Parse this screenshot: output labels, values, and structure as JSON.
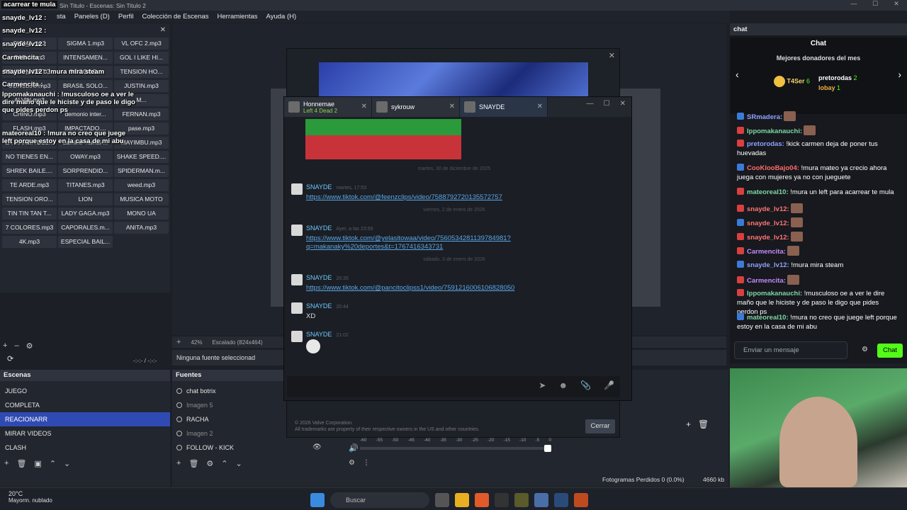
{
  "window": {
    "title": "Sin Titulo - Escenas: Sin Titulo 2",
    "ticker": "acarrear te mula"
  },
  "menu": [
    "sta",
    "Paneles (D)",
    "Perfil",
    "Colección de Escenas",
    "Herramientas",
    "Ayuda (H)"
  ],
  "sounds": [
    "SIGMA.mp3",
    "SIGMA 1.mp3",
    "VL OFC 2.mp3",
    "SAD 1.mp3",
    "INTENSAMEN...",
    "GOL I LIKE HI...",
    "TENSION OBITO...",
    "GOGOGO...",
    "TENSION HO...",
    "CONSEJO.mp3",
    "BRASIL SOLO...",
    "JUSTIN.mp3",
    "ALVIN.mp3",
    "...",
    "M...",
    "CHINO.mp3",
    "demonio inter...",
    "FERNAN.mp3",
    "FLASH.mp3",
    "IMPACTADO....",
    "pase.mp3",
    "LA MARCA DEL...",
    "Lamine-Yamal-...",
    "MAYIMBU.mp3",
    "NO TIENES EN...",
    "OWAY.mp3",
    "SHAKE SPEED....",
    "SHREK BAILE....",
    "SORPRENDID...",
    "SPIDERMAN.m...",
    "TE ARDE.mp3",
    "TITANES.mp3",
    "weed.mp3",
    "TENSION ORO...",
    "LION",
    "MUSICA MOTO",
    "TIN TIN TAN T...",
    "LADY GAGA.mp3",
    "MONO UA",
    "7 COLORES.mp3",
    "CAPORALES.m...",
    "ANITA.mp3",
    "4K.mp3",
    "ESPECIAL BAIL..."
  ],
  "overlay_chat": [
    {
      "t": "snayde_lv12 :"
    },
    {
      "t": "snayde_lv12 :"
    },
    {
      "t": "snayde_lv12 :"
    },
    {
      "t": "Carmencita :"
    },
    {
      "t": "snayde_lv12 : !mura mira steam"
    },
    {
      "t": "Carmencita :"
    },
    {
      "t": "Ippomakanauchi : !musculoso oe a ver le dire maño que le hiciste y de paso le digo que pides perdon ps"
    },
    {
      "t": "mateoreal10 : !mura no creo que juege left porque estoy en la casa de mi abu"
    }
  ],
  "preview_status": {
    "zoom": "42%",
    "scaling": "Escalado (824x464)",
    "time": "-:-:- / -:-:-"
  },
  "source_bar": {
    "label": "Ninguna fuente seleccionad"
  },
  "scenes": {
    "title": "Escenas",
    "items": [
      "JUEGO",
      "COMPLETA",
      "REACIONARR",
      "MIRAR VIDEOS",
      "CLASH"
    ],
    "selected": 2
  },
  "sources": {
    "title": "Fuentes",
    "items": [
      "chat botrix",
      "Imagen 5",
      "RACHA",
      "Imagen 2",
      "FOLLOW - KICK"
    ]
  },
  "mixer": {
    "ticks": [
      "-60",
      "-55",
      "-50",
      "-45",
      "-40",
      "-35",
      "-30",
      "-25",
      "-20",
      "-15",
      "-10",
      "-5",
      "0"
    ],
    "frames": "Fotogramas Perdidos 0 (0.0%)",
    "bitrate": "4660 kb"
  },
  "steam": {
    "tabs": [
      {
        "name": "Honnemae",
        "game": "Left 4 Dead 2"
      },
      {
        "name": "sykrouw",
        "game": ""
      },
      {
        "name": "SNAYDE",
        "game": ""
      }
    ],
    "messages": [
      {
        "sep": "martes, 30 de diciembre de 2025",
        "user": "SNAYDE",
        "time": "martes, 17:53",
        "text": "https://www.tiktok.com/@feenzclips/video/7588792720135572757",
        "link": true
      },
      {
        "sep": "viernes, 2 de enero de 2026",
        "user": "SNAYDE",
        "time": "Ayer, a las 23:59",
        "text": "https://www.tiktok.com/@yelasitowaa/video/7560534281139784981?q=makanaky%20deportes&t=1767416343731",
        "link": true
      },
      {
        "sep": "sábado, 3 de enero de 2026",
        "user": "SNAYDE",
        "time": "20:35",
        "text": "https://www.tiktok.com/@pancitoclipss1/video/7591216006106828050",
        "link": true
      },
      {
        "sep": "",
        "user": "SNAYDE",
        "time": "20:44",
        "text": "XD",
        "link": false
      },
      {
        "sep": "",
        "user": "SNAYDE",
        "time": "21:02",
        "text": "",
        "link": false
      }
    ],
    "footer1": "© 2026 Valve Corporation.",
    "footer2": "All trademarks are property of their respective owners in the US and other countries.",
    "close": "Cerrar"
  },
  "rchat": {
    "dock_title": "chat",
    "title": "Chat",
    "donors_title": "Mejores donadores del mes",
    "donors": [
      {
        "name": "T4Ser",
        "amount": "6"
      },
      {
        "name": "pretorodas",
        "amount": "2"
      },
      {
        "name": "lobay",
        "amount": "1"
      }
    ],
    "lines": [
      {
        "user": "SRmadera:",
        "text": ""
      },
      {
        "user": "Ippomakanauchi:",
        "text": ""
      },
      {
        "user": "pretorodas:",
        "text": "!kick carmen deja de poner tus huevadas"
      },
      {
        "user": "CooKlooBajo04:",
        "text": "!mura mateo ya crecio ahora juega con mujeres ya no con jueguete"
      },
      {
        "user": "mateoreal10:",
        "text": "!mura un left para acarrear te mula"
      },
      {
        "user": "snayde_lv12:",
        "text": ""
      },
      {
        "user": "snayde_lv12:",
        "text": ""
      },
      {
        "user": "snayde_lv12:",
        "text": ""
      },
      {
        "user": "Carmencita:",
        "text": ""
      },
      {
        "user": "snayde_lv12:",
        "text": "!mura mira steam"
      },
      {
        "user": "Carmencita:",
        "text": ""
      },
      {
        "user": "Ippomakanauchi:",
        "text": "!musculoso oe a ver le dire maño que le hiciste y de paso le digo que pides perdon ps"
      },
      {
        "user": "mateoreal10:",
        "text": "!mura no creo que juege left porque estoy en la casa de mi abu"
      }
    ],
    "placeholder": "Enviar un mensaje",
    "send": "Chat"
  },
  "taskbar": {
    "temp": "20°C",
    "weather": "Mayorm. nublado",
    "search": "Buscar"
  }
}
